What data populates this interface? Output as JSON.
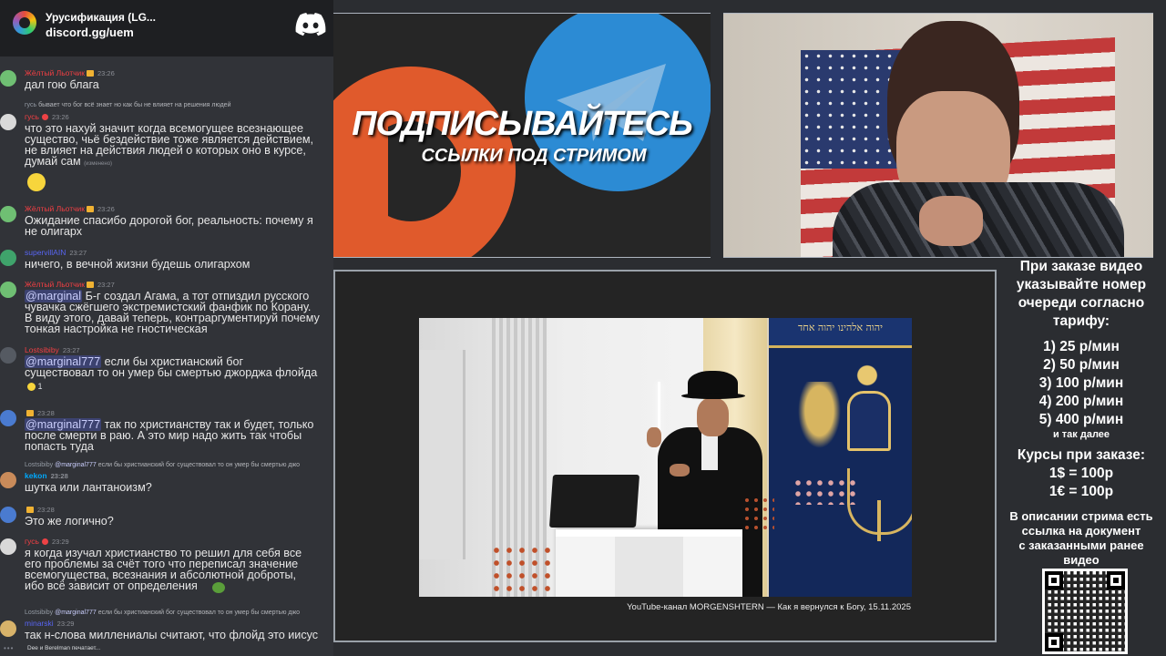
{
  "chat": {
    "server_name": "Урусификация (LG...",
    "invite": "discord.gg/uem",
    "messages": [
      {
        "user": "Жёлтый Льотчик",
        "time": "23:26",
        "color": "#f23f43",
        "text": "дал гою блага"
      },
      {
        "reply_user": "гусь",
        "reply_text": "бывает что бог всё знает но как бы не влияет на решения людей",
        "user": "гусь",
        "time": "23:26",
        "color": "#f23f43",
        "text": "что это нахуй значит когда всемогущее всезнающее\nсущество, чьё бездействие тоже является действием,\nне влияет на действия людей о которых оно в курсе,\nдумай сам",
        "edited": "(изменено)"
      },
      {
        "user": "Жёлтый Льотчик",
        "time": "23:26",
        "color": "#f23f43",
        "text": "Ожидание спасибо дорогой бог, реальность: почему я\nне олигарх"
      },
      {
        "user": "supervillAIN",
        "time": "23:27",
        "color": "#5865f2",
        "text": "ничего, в вечной жизни будешь олигархом"
      },
      {
        "user": "Жёлтый Льотчик",
        "time": "23:27",
        "color": "#f23f43",
        "mention": "@marginal",
        "text": " Б-г создал Агама, а тот отпиздил русского\nчувачка сжёгшего экстремистский фанфик по Корану.\nВ виду этого, давай теперь, контраргументируй почему\nтонкая настройка не гностическая"
      },
      {
        "user": "Lostsibiby",
        "time": "23:27",
        "color": "#f23f43",
        "mention": "@marginal777",
        "text": " если бы христианский бог\nсуществовал то он умер бы смертью джорджа флойда",
        "reaction_count": "1"
      },
      {
        "user": "",
        "time": "23:28",
        "color": "#f0b232",
        "mention": "@marginal777",
        "text": " так по христианству так и будет, только\nпосле смерти в раю. А это мир надо жить так чтобы\nпопасть туда"
      },
      {
        "reply_user": "Lostsibiby",
        "reply_mention": "@marginal777",
        "reply_text": "если бы христианский бог существовал то он умер бы смертью джо",
        "user": "kekon",
        "time": "23:28",
        "color": "#00a8fc",
        "text": "шутка или лантаноизм?"
      },
      {
        "user": "",
        "time": "23:28",
        "color": "#f0b232",
        "text": "Это же логично?"
      },
      {
        "user": "гусь",
        "time": "23:29",
        "color": "#f23f43",
        "text": "я когда изучал христианство то решил для себя все\nего проблемы за счёт того что переписал значение\nвсемогущества, всезнания и абсолютной доброты,\nибо всё зависит от определения"
      },
      {
        "reply_user": "Lostsibiby",
        "reply_mention": "@marginal777",
        "reply_text": "если бы христианский бог существовал то он умер бы смертью джо",
        "user": "minarski",
        "time": "23:29",
        "color": "#5865f2",
        "text": "так н-слова миллениалы считают, что флойд это иисус"
      }
    ],
    "typing": "Dee и Berelman печатает..."
  },
  "banner": {
    "title": "ПОДПИСЫВАЙТЕСЬ",
    "subtitle": "ССЫЛКИ ПОД СТРИМОМ",
    "patreon_color": "#e05a2c",
    "telegram_color": "#2c8bd4"
  },
  "video": {
    "caption": "YouTube-канал MORGENSHTERN — Как я вернулся к Богу, 15.11.2025",
    "tapestry_text": "יהוה אלהינו יהוה אחד"
  },
  "info": {
    "heading": [
      "При заказе видео",
      "указывайте номер",
      "очереди согласно",
      "тарифу:"
    ],
    "tariffs": [
      "1) 25 р/мин",
      "2) 50 р/мин",
      "3) 100 р/мин",
      "4) 200 р/мин",
      "5) 400 р/мин"
    ],
    "and_so_on": "и так далее",
    "rates_heading": "Курсы при заказе:",
    "rates": [
      "1$ = 100р",
      "1€ = 100р"
    ],
    "description": [
      "В описании стрима есть",
      "ссылка на документ",
      "с заказанными ранее",
      "видео"
    ]
  }
}
